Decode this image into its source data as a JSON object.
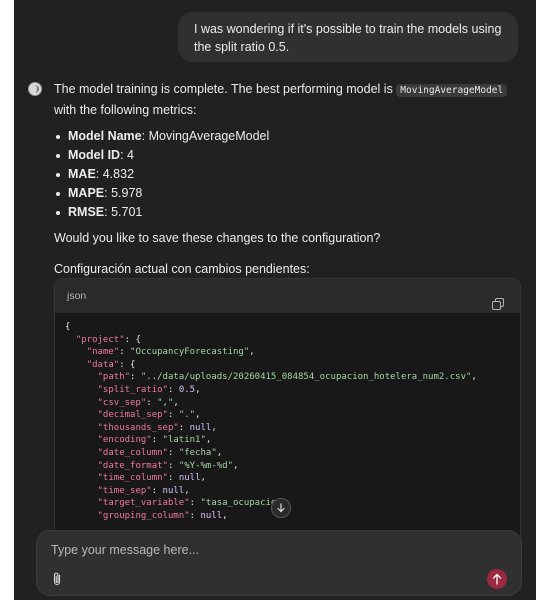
{
  "user_message": "I was wondering if it's possible to train the models using the split ratio 0.5.",
  "assistant": {
    "intro_before": "The model training is complete. The best performing model is ",
    "intro_code": "MovingAverageModel",
    "intro_after": " with the following metrics:",
    "metrics": [
      {
        "label": "Model Name",
        "value": "MovingAverageModel"
      },
      {
        "label": "Model ID",
        "value": "4"
      },
      {
        "label": "MAE",
        "value": "4.832"
      },
      {
        "label": "MAPE",
        "value": "5.978"
      },
      {
        "label": "RMSE",
        "value": "5.701"
      }
    ],
    "question": "Would you like to save these changes to the configuration?",
    "config_title": "Configuración actual con cambios pendientes:"
  },
  "code_block": {
    "language": "json",
    "lines": [
      {
        "indent": 0,
        "text": "{"
      },
      {
        "indent": 1,
        "key": "project",
        "after": ": {"
      },
      {
        "indent": 2,
        "key": "name",
        "value": "OccupancyForecasting",
        "vtype": "s"
      },
      {
        "indent": 2,
        "key": "data",
        "after": ": {"
      },
      {
        "indent": 3,
        "key": "path",
        "value": "../data/uploads/20260415_084854_ocupacion_hotelera_num2.csv",
        "vtype": "s"
      },
      {
        "indent": 3,
        "key": "split_ratio",
        "value": "0.5",
        "vtype": "n"
      },
      {
        "indent": 3,
        "key": "csv_sep",
        "value": ",",
        "vtype": "s"
      },
      {
        "indent": 3,
        "key": "decimal_sep",
        "value": ".",
        "vtype": "s"
      },
      {
        "indent": 3,
        "key": "thousands_sep",
        "value": "null",
        "vtype": "n"
      },
      {
        "indent": 3,
        "key": "encoding",
        "value": "latin1",
        "vtype": "s"
      },
      {
        "indent": 3,
        "key": "date_column",
        "value": "fecha",
        "vtype": "s"
      },
      {
        "indent": 3,
        "key": "date_format",
        "value": "%Y-%m-%d",
        "vtype": "s"
      },
      {
        "indent": 3,
        "key": "time_column",
        "value": "null",
        "vtype": "n"
      },
      {
        "indent": 3,
        "key": "time_sep",
        "value": "null",
        "vtype": "n"
      },
      {
        "indent": 3,
        "key": "target_variable",
        "value": "tasa_ocupacion",
        "vtype": "s",
        "truncated": true
      },
      {
        "indent": 3,
        "key": "grouping_column",
        "value": "null",
        "vtype": "n"
      }
    ]
  },
  "composer": {
    "placeholder": "Type your message here..."
  },
  "colors": {
    "background": "#212121",
    "bubble": "#303030",
    "code_key": "#f07a9a",
    "code_string": "#a5d6a7",
    "code_literal": "#d7c2ff",
    "send_button": "#9a2a42"
  },
  "icons": {
    "copy": "copy-icon",
    "attach": "paperclip-icon",
    "send": "arrow-up-icon",
    "scroll": "arrow-down-icon"
  }
}
